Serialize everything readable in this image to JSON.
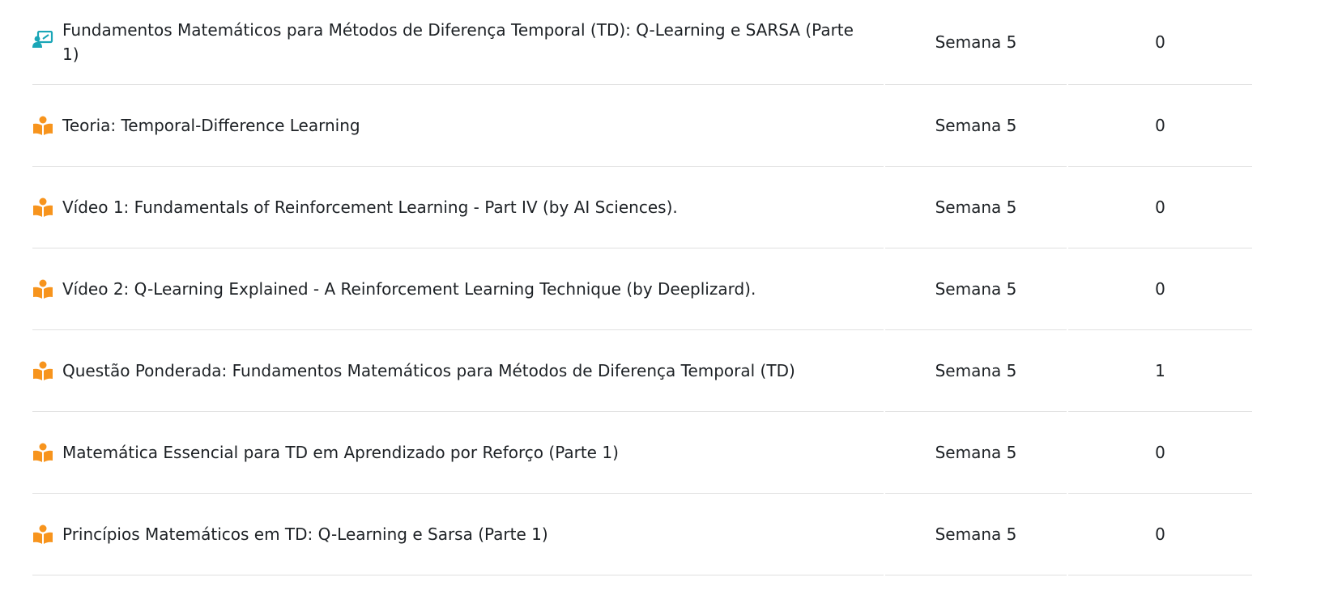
{
  "colors": {
    "meeting_icon": "#1aa6b7",
    "book_icon": "#f7941d",
    "divider": "#e0e0e0",
    "text": "#1d2125"
  },
  "rows": [
    {
      "icon": "meeting-icon",
      "title": "Fundamentos Matemáticos para Métodos de Diferença Temporal (TD): Q-Learning e SARSA (Parte 1)",
      "week": "Semana 5",
      "count": "0"
    },
    {
      "icon": "book-reader-icon",
      "title": "Teoria: Temporal-Difference Learning",
      "week": "Semana 5",
      "count": "0"
    },
    {
      "icon": "book-reader-icon",
      "title": "Vídeo 1: Fundamentals of Reinforcement Learning - Part IV (by AI Sciences).",
      "week": "Semana 5",
      "count": "0"
    },
    {
      "icon": "book-reader-icon",
      "title": "Vídeo 2: Q-Learning Explained - A Reinforcement Learning Technique (by Deeplizard).",
      "week": "Semana 5",
      "count": "0"
    },
    {
      "icon": "book-reader-icon",
      "title": "Questão Ponderada: Fundamentos Matemáticos para Métodos de Diferença Temporal (TD)",
      "week": "Semana 5",
      "count": "1"
    },
    {
      "icon": "book-reader-icon",
      "title": "Matemática Essencial para TD em Aprendizado por Reforço (Parte 1)",
      "week": "Semana 5",
      "count": "0"
    },
    {
      "icon": "book-reader-icon",
      "title": "Princípios Matemáticos em TD: Q-Learning e Sarsa (Parte 1)",
      "week": "Semana 5",
      "count": "0"
    }
  ]
}
